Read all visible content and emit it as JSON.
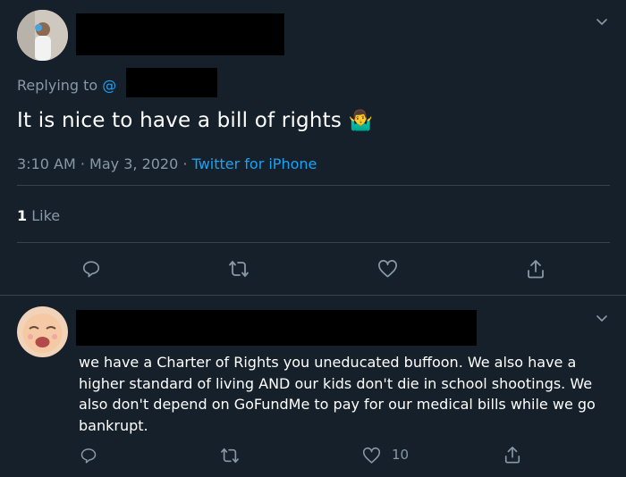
{
  "tweet": {
    "replying_label": "Replying to ",
    "replying_handle_prefix": "@",
    "text": "It is nice to have a bill of rights",
    "emoji": "🤷‍♂️",
    "time": "3:10 AM",
    "sep1": "·",
    "date": "May 3, 2020",
    "sep2": "·",
    "source": "Twitter for iPhone",
    "likes_count": "1",
    "likes_label": "Like"
  },
  "reply": {
    "text": "we have a Charter of Rights you uneducated buffoon. We also have a higher standard of living AND our kids don't die in school shootings. We also don't depend on GoFundMe to pay for our medical bills while we go bankrupt.",
    "like_count": "10"
  },
  "icons": {
    "reply": "reply-icon",
    "retweet": "retweet-icon",
    "like": "heart-icon",
    "share": "share-icon",
    "more": "chevron-down-icon"
  },
  "colors": {
    "background": "#15202b",
    "muted": "#8899a6",
    "link": "#1da1f2",
    "divider": "#38444d"
  }
}
